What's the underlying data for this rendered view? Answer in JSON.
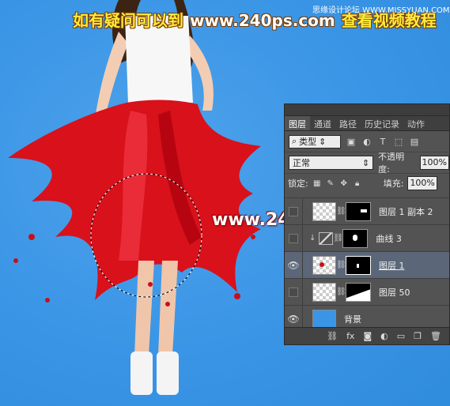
{
  "banner": {
    "left_text": "如有疑问可以到",
    "url": "www.240ps.com",
    "right_text": "查看视频教程"
  },
  "corner_mark": "思缘设计论坛 WWW.MISSYUAN.COM",
  "watermark": "www.240ps.com",
  "panel": {
    "tabs": [
      {
        "label": "图层",
        "active": true
      },
      {
        "label": "通道",
        "active": false
      },
      {
        "label": "路径",
        "active": false
      },
      {
        "label": "历史记录",
        "active": false
      },
      {
        "label": "动作",
        "active": false
      }
    ],
    "filter": {
      "kind_label": "类型"
    },
    "blend_mode": "正常",
    "opacity_label": "不透明度:",
    "opacity_value": "100%",
    "lock_label": "锁定:",
    "fill_label": "填充:",
    "fill_value": "100%",
    "layers": [
      {
        "name": "图层 1 副本 2",
        "visible": false,
        "type": "pixel",
        "selected": false
      },
      {
        "name": "曲线 3",
        "visible": false,
        "type": "adjustment",
        "selected": false
      },
      {
        "name": "图层 1",
        "visible": true,
        "type": "pixel",
        "selected": true
      },
      {
        "name": "图层 50",
        "visible": false,
        "type": "pixel",
        "selected": false
      },
      {
        "name": "背景",
        "visible": true,
        "type": "background",
        "selected": false
      }
    ],
    "footer_icons": [
      "link-icon",
      "fx-icon",
      "add-mask-icon",
      "adjustment-icon",
      "group-folder-icon",
      "new-layer-icon",
      "trash-icon"
    ]
  },
  "colors": {
    "canvas_bg": "#3a95e6",
    "skirt_red": "#d8111b",
    "banner_text": "#ffeb3b",
    "panel_bg": "#535353",
    "selected_layer": "#5b6779"
  }
}
